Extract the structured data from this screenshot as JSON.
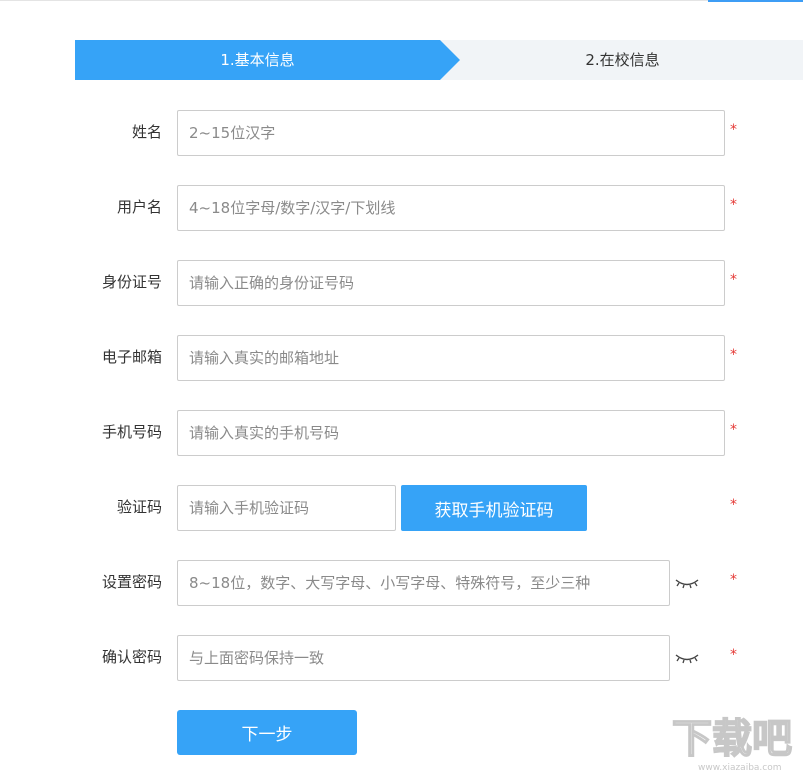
{
  "steps": [
    {
      "label": "1.基本信息",
      "active": true
    },
    {
      "label": "2.在校信息",
      "active": false
    }
  ],
  "form": {
    "required_mark": "*",
    "name": {
      "label": "姓名",
      "placeholder": "2~15位汉字"
    },
    "username": {
      "label": "用户名",
      "placeholder": "4~18位字母/数字/汉字/下划线"
    },
    "id_number": {
      "label": "身份证号",
      "placeholder": "请输入正确的身份证号码"
    },
    "email": {
      "label": "电子邮箱",
      "placeholder": "请输入真实的邮箱地址"
    },
    "phone": {
      "label": "手机号码",
      "placeholder": "请输入真实的手机号码"
    },
    "verify_code": {
      "label": "验证码",
      "placeholder": "请输入手机验证码",
      "button_label": "获取手机验证码"
    },
    "password": {
      "label": "设置密码",
      "placeholder": "8~18位，数字、大写字母、小写字母、特殊符号，至少三种"
    },
    "confirm_password": {
      "label": "确认密码",
      "placeholder": "与上面密码保持一致"
    },
    "next_label": "下一步"
  },
  "icons": {
    "eye": "eye-closed-icon"
  },
  "colors": {
    "accent": "#36a3f7",
    "required": "#e53935",
    "step_inactive_bg": "#f1f4f7"
  },
  "watermark": {
    "text": "下载吧",
    "url_text": "www.xiazaiba.com"
  }
}
